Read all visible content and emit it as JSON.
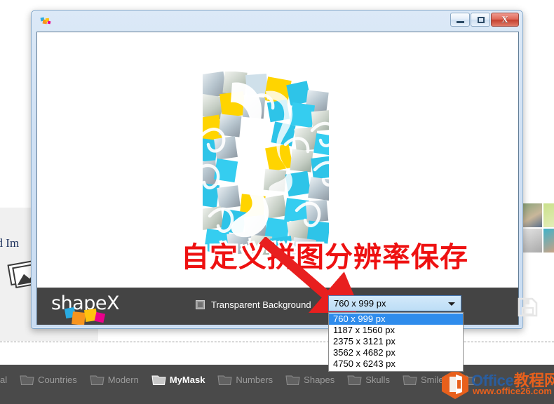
{
  "window": {
    "title": "",
    "icon": "shapex-app-icon",
    "controls": {
      "minimize": "minimize-icon",
      "maximize": "maximize-icon",
      "close": "X"
    }
  },
  "canvas": {
    "artwork_name": "photo-mosaic-collage",
    "annotation_cn": "自定义拼图分辨率保存",
    "annotation_color": "#ee1111",
    "arrow_color": "#e81f1f"
  },
  "footer": {
    "brand": "shapeX",
    "transparent_background_label": "Transparent Background",
    "transparent_background_checked": false,
    "save_icon": "floppy-disk-save-icon"
  },
  "resolution_combo": {
    "name": "resolution-dropdown",
    "selected": "760 x 999 px",
    "expanded": true,
    "options": [
      "760 x 999 px",
      "1187 x 1560 px",
      "2375 x 3121 px",
      "3562 x 4682 px",
      "4750 x 6243 px"
    ],
    "selected_index": 0
  },
  "background_app": {
    "load_images_label": "ad Im",
    "photo_icon": "photo-stack-icon",
    "categories": [
      {
        "label": "al",
        "active": false,
        "partial": true
      },
      {
        "label": "Countries",
        "active": false
      },
      {
        "label": "Modern",
        "active": false
      },
      {
        "label": "MyMask",
        "active": true
      },
      {
        "label": "Numbers",
        "active": false
      },
      {
        "label": "Shapes",
        "active": false
      },
      {
        "label": "Skulls",
        "active": false
      },
      {
        "label": "Smiley",
        "active": false
      }
    ]
  },
  "watermark": {
    "title_en": "Office",
    "title_cn": "教程网",
    "url": "www.office26.com",
    "logo": "office-hexagon-logo",
    "brand_color": "#e8601c",
    "title_color": "#2a5d9e"
  }
}
